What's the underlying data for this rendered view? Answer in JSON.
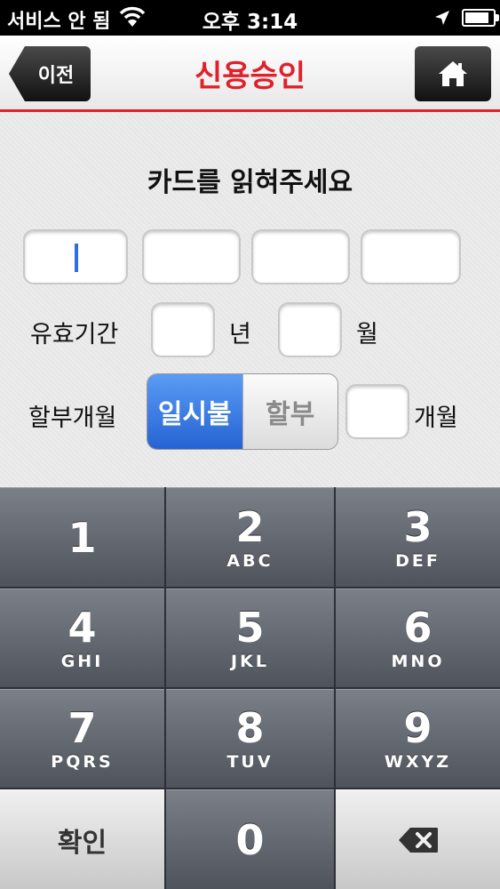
{
  "status": {
    "carrier": "서비스 안 됨",
    "time": "오후 3:14",
    "battery_level": 0.85
  },
  "header": {
    "back_label": "이전",
    "title": "신용승인"
  },
  "form": {
    "title": "카드를 읽혀주세요",
    "card_number_fields": [
      "",
      "",
      "",
      ""
    ],
    "expiry_label": "유효기간",
    "year_value": "",
    "year_unit": "년",
    "month_value": "",
    "month_unit": "월",
    "installment_label": "할부개월",
    "segments": [
      "일시불",
      "할부"
    ],
    "selected_segment": "일시불",
    "months_value": "",
    "months_unit": "개월"
  },
  "keypad": {
    "keys": [
      {
        "num": "1",
        "letters": ""
      },
      {
        "num": "2",
        "letters": "ABC"
      },
      {
        "num": "3",
        "letters": "DEF"
      },
      {
        "num": "4",
        "letters": "GHI"
      },
      {
        "num": "5",
        "letters": "JKL"
      },
      {
        "num": "6",
        "letters": "MNO"
      },
      {
        "num": "7",
        "letters": "PQRS"
      },
      {
        "num": "8",
        "letters": "TUV"
      },
      {
        "num": "9",
        "letters": "WXYZ"
      }
    ],
    "confirm_label": "확인",
    "zero": "0"
  },
  "colors": {
    "accent_red": "#e0202a",
    "segment_blue": "#2563d3"
  }
}
